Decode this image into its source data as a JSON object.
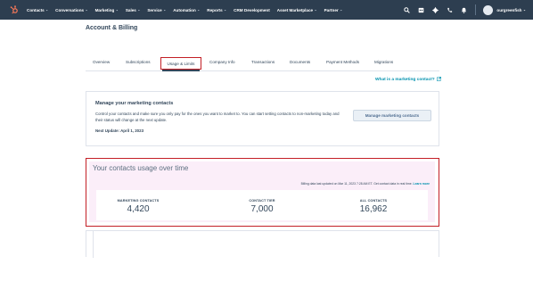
{
  "nav": {
    "items": [
      {
        "label": "Contacts"
      },
      {
        "label": "Conversations"
      },
      {
        "label": "Marketing"
      },
      {
        "label": "Sales"
      },
      {
        "label": "Service"
      },
      {
        "label": "Automation"
      },
      {
        "label": "Reports"
      },
      {
        "label": "CRM Development"
      },
      {
        "label": "Asset Marketplace"
      },
      {
        "label": "Partner"
      }
    ],
    "account_name": "ourgreenfish",
    "caret": "⌄",
    "colors": {
      "background": "#2d3e50",
      "accent": "#ff7a59"
    }
  },
  "header": {
    "title": "Account & Billing"
  },
  "tabs": [
    {
      "label": "Overview"
    },
    {
      "label": "Subscriptions"
    },
    {
      "label": "Usage & Limits",
      "active": true
    },
    {
      "label": "Company Info"
    },
    {
      "label": "Transactions"
    },
    {
      "label": "Documents"
    },
    {
      "label": "Payment Methods"
    },
    {
      "label": "Migrations"
    }
  ],
  "help_link": {
    "label": "What is a marketing contact?",
    "icon": "external-link-icon"
  },
  "manage": {
    "title": "Manage your marketing contacts",
    "body": "Control your contacts and make sure you only pay for the ones you want to market to. You can start setting contacts to non-marketing today and their status will change at the next update.",
    "next_update": "Next Update: April 1, 2023",
    "button_label": "Manage marketing contacts"
  },
  "usage": {
    "title": "Your contacts usage over time",
    "billing_note": "Billing data last updated on Mar 11, 2023 7:28 AM ET.",
    "realtime_prefix": "Get contact data in real time.",
    "learn_more": "Learn more",
    "stats": [
      {
        "label": "MARKETING CONTACTS",
        "value": "4,420"
      },
      {
        "label": "CONTACT TIER",
        "value": "7,000"
      },
      {
        "label": "ALL CONTACTS",
        "value": "16,962"
      }
    ],
    "highlight_color": "#c31f26"
  }
}
